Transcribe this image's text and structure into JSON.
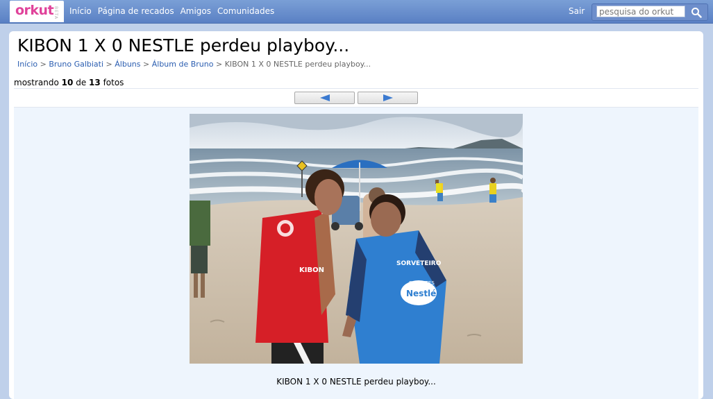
{
  "header": {
    "logo": "orkut",
    "logo_tag": "BETA",
    "nav": [
      "Início",
      "Página de recados",
      "Amigos",
      "Comunidades"
    ],
    "logout": "Sair",
    "search_placeholder": "pesquisa do orkut"
  },
  "page": {
    "title": "KIBON 1 X 0 NESTLE perdeu playboy...",
    "breadcrumb": [
      "Início",
      "Bruno Galbiati",
      "Álbuns",
      "Álbum de Bruno",
      "KIBON 1 X 0 NESTLE perdeu playboy..."
    ],
    "breadcrumb_sep": ">",
    "counter_prefix": "mostrando",
    "counter_current": "10",
    "counter_mid": "de",
    "counter_total": "13",
    "counter_suffix": "fotos",
    "caption": "KIBON 1 X 0 NESTLE perdeu playboy..."
  },
  "photo": {
    "shirt_left": "KIBON",
    "shirt_right_top": "SORVETEIRO",
    "shirt_right_mid": "SORVETES",
    "shirt_right_logo": "Nestlé"
  },
  "colors": {
    "topbar": "#6a8fd0",
    "link": "#2a5db0",
    "logo": "#e0429a",
    "photo_bg": "#eef5fd"
  }
}
